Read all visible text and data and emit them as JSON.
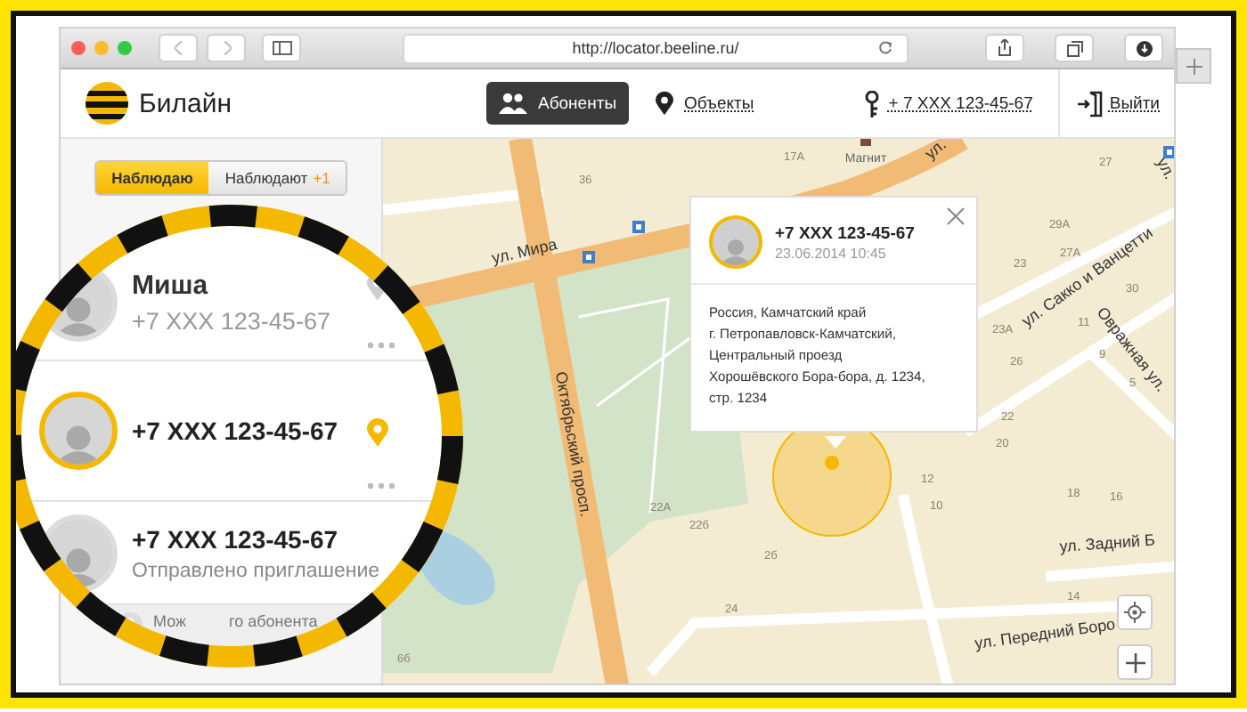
{
  "browser": {
    "url": "http://locator.beeline.ru/"
  },
  "header": {
    "logo": "Билайн",
    "nav": [
      {
        "label": "Абоненты",
        "kind": "people",
        "selected": true
      },
      {
        "label": "Объекты",
        "kind": "pin",
        "selected": false
      }
    ],
    "account": "+ 7 XXX 123-45-67",
    "logout": "Выйти"
  },
  "sidebar": {
    "tabs": [
      {
        "label": "Наблюдаю",
        "selected": true
      },
      {
        "label": "Наблюдают",
        "badge": "+1",
        "selected": false
      }
    ]
  },
  "magnifier": {
    "contacts": [
      {
        "name": "Миша",
        "phone": "+7 XXX 123-45-67",
        "kind": "located",
        "selected": false
      },
      {
        "phone": "+7 XXX 123-45-67",
        "kind": "located",
        "selected": true
      },
      {
        "phone": "+7 XXX 123-45-67",
        "status": "Отправлено приглашение",
        "kind": "invited",
        "selected": false
      }
    ],
    "footer": [
      "Мож",
      "го абонента"
    ]
  },
  "map": {
    "streets": [
      "ул. Мира",
      "Октябрьский просп.",
      "ул. Сакко и Ванцетти",
      "Овражная ул.",
      "ул. Задний Б",
      "ул. Передний Боро",
      "ул.",
      "ул."
    ],
    "shop": "Магнит",
    "houses": [
      "17А",
      "36",
      "27",
      "29А",
      "27А",
      "30",
      "23",
      "23А",
      "26",
      "11",
      "9",
      "5",
      "22",
      "20",
      "12",
      "10",
      "18",
      "16",
      "22А",
      "22б",
      "2б",
      "24",
      "14",
      "6б"
    ],
    "popup": {
      "phone": "+7 XXX 123-45-67",
      "time": "23.06.2014 10:45",
      "address": [
        "Россия, Камчатский край",
        "г. Петропавловск-Камчатский,",
        "Центральный проезд",
        "Хорошёвского Бора-бора, д. 1234,",
        "стр. 1234"
      ]
    }
  }
}
